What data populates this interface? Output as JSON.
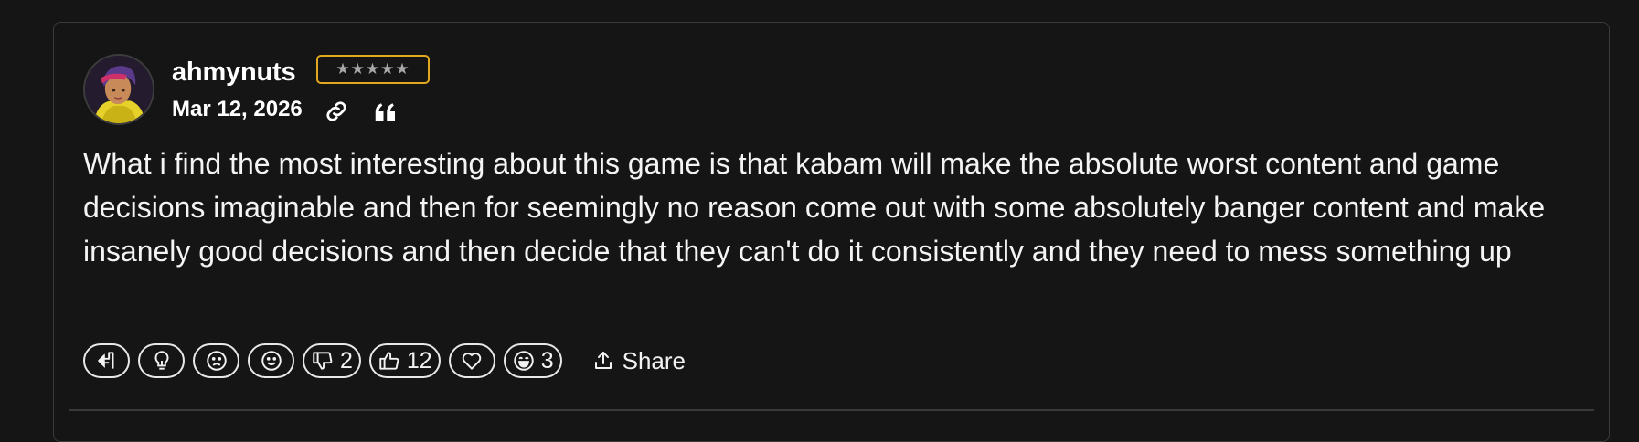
{
  "comment": {
    "username": "ahmynuts",
    "rank_stars": "★★★★★",
    "date": "Mar 12, 2026",
    "body": "What i find the most interesting about this game is that kabam will make the absolute worst content and game decisions imaginable and then for seemingly no reason come out with some absolutely banger content and make insanely good decisions and then decide that they can't do it consistently and they need to mess something up",
    "badge_color": "#e1a91d"
  },
  "reactions": [
    {
      "icon": "reply-arrow-icon",
      "count": ""
    },
    {
      "icon": "lightbulb-icon",
      "count": ""
    },
    {
      "icon": "sad-face-icon",
      "count": ""
    },
    {
      "icon": "smile-face-icon",
      "count": ""
    },
    {
      "icon": "thumbs-down-icon",
      "count": "2"
    },
    {
      "icon": "thumbs-up-icon",
      "count": "12"
    },
    {
      "icon": "heart-icon",
      "count": ""
    },
    {
      "icon": "laugh-face-icon",
      "count": "3"
    }
  ],
  "share": {
    "label": "Share",
    "icon": "share-upload-icon"
  },
  "meta_icons": [
    "link-icon",
    "quote-icon"
  ]
}
